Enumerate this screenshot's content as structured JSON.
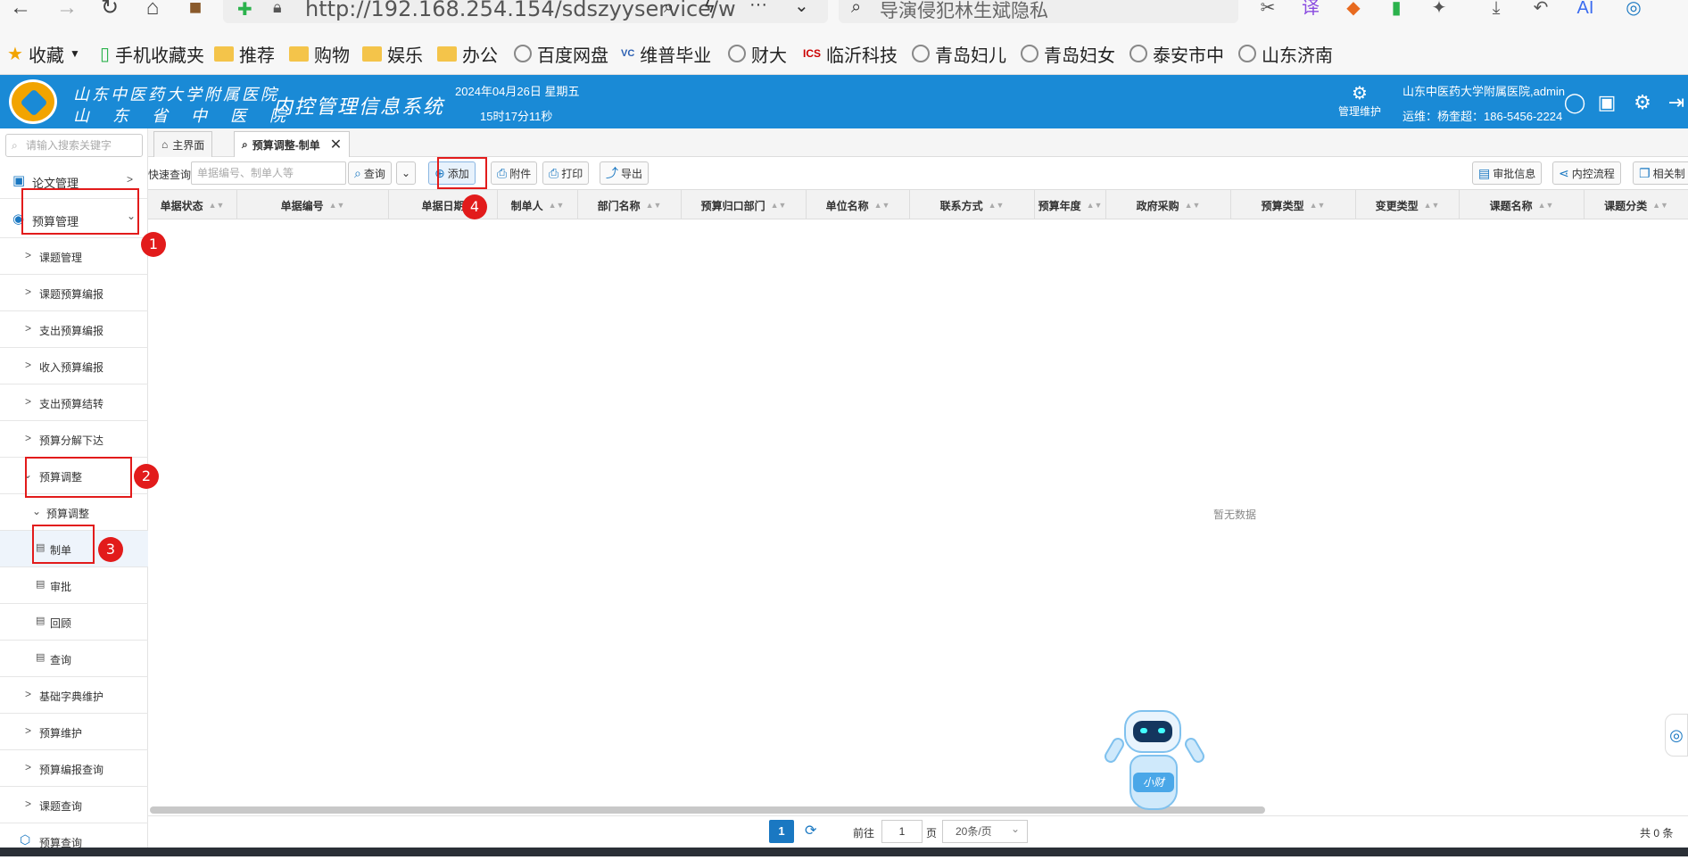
{
  "browser": {
    "url": "http://192.168.254.154/sdszyyservice/w",
    "search_placeholder": "导演侵犯林生斌隐私",
    "bookmarks": [
      "收藏",
      "手机收藏夹",
      "推荐",
      "购物",
      "娱乐",
      "办公",
      "百度网盘",
      "维普毕业",
      "财大",
      "临沂科技",
      "青岛妇儿",
      "青岛妇女",
      "泰安市中",
      "山东济南"
    ]
  },
  "header": {
    "hospital_line1": "山东中医药大学附属医院",
    "hospital_line2": "山东省中医院",
    "system_title": "内控管理信息系统",
    "date": "2024年04月26日 星期五",
    "time": "15时17分11秒",
    "mgmt_label": "管理维护",
    "user": "山东中医药大学附属医院,admin",
    "ops": "运维：杨奎超：186-5456-2224"
  },
  "sidebar": {
    "search_placeholder": "请输入搜索关键字",
    "items": [
      {
        "label": "论文管理"
      },
      {
        "label": "预算管理"
      },
      {
        "label": "课题管理"
      },
      {
        "label": "课题预算编报"
      },
      {
        "label": "支出预算编报"
      },
      {
        "label": "收入预算编报"
      },
      {
        "label": "支出预算结转"
      },
      {
        "label": "预算分解下达"
      },
      {
        "label": "预算调整"
      },
      {
        "label": "预算调整"
      },
      {
        "label": "制单"
      },
      {
        "label": "审批"
      },
      {
        "label": "回顾"
      },
      {
        "label": "查询"
      },
      {
        "label": "基础字典维护"
      },
      {
        "label": "预算维护"
      },
      {
        "label": "预算编报查询"
      },
      {
        "label": "课题查询"
      },
      {
        "label": "预算查询"
      }
    ]
  },
  "tabs": [
    {
      "label": "主界面"
    },
    {
      "label": "预算调整-制单"
    }
  ],
  "toolbar": {
    "quick_label": "快速查询",
    "quick_placeholder": "单据编号、制单人等",
    "query": "查询",
    "add": "添加",
    "attach": "附件",
    "print": "打印",
    "export": "导出",
    "approve_info": "审批信息",
    "flow": "内控流程",
    "related": "相关制"
  },
  "columns": [
    "单据状态",
    "单据编号",
    "单据日期",
    "制单人",
    "部门名称",
    "预算归口部门",
    "单位名称",
    "联系方式",
    "预算年度",
    "政府采购",
    "预算类型",
    "变更类型",
    "课题名称",
    "课题分类"
  ],
  "empty_text": "暂无数据",
  "robot_label": "小财",
  "pager": {
    "current": "1",
    "goto": "前往",
    "page_input": "1",
    "page_unit": "页",
    "page_size": "20条/页",
    "total": "共 0 条"
  },
  "annotations": [
    "1",
    "2",
    "3",
    "4"
  ],
  "colors": {
    "header": "#1a8ad6",
    "accent": "#1a78c2",
    "annotation": "#e21b1b"
  }
}
